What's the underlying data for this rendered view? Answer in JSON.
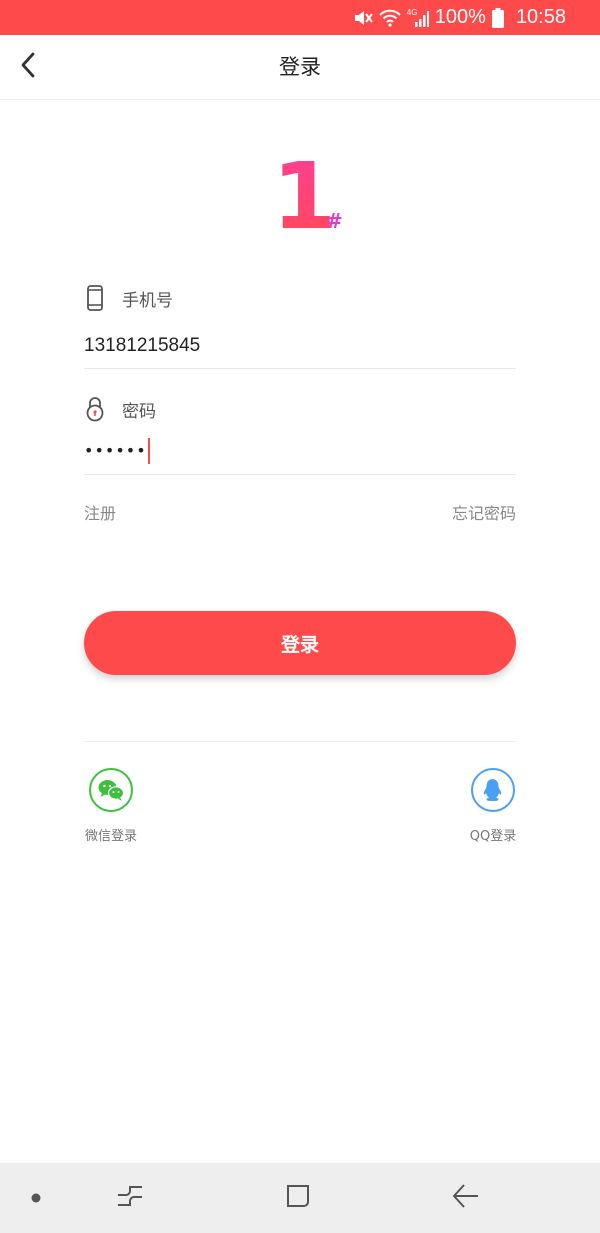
{
  "status_bar": {
    "battery": "100%",
    "clock": "10:58",
    "network": "4G",
    "background": "#ff4a4c"
  },
  "nav": {
    "title": "登录",
    "back_icon": "chevron-left-icon"
  },
  "logo": {
    "number": "1",
    "symbol": "#",
    "gradient": [
      "#ff3d78",
      "#ff6a3d"
    ]
  },
  "form": {
    "phone": {
      "label": "手机号",
      "icon": "phone-icon",
      "value": "13181215845"
    },
    "password": {
      "label": "密码",
      "icon": "lock-icon",
      "masked": "••••••"
    }
  },
  "links": {
    "register": "注册",
    "forgot": "忘记密码"
  },
  "login_button": {
    "label": "登录",
    "color": "#ff4a4c"
  },
  "social": {
    "wechat": {
      "label": "微信登录",
      "icon": "wechat-icon",
      "color": "#3dc13c"
    },
    "qq": {
      "label": "QQ登录",
      "icon": "qq-icon",
      "color": "#4a9ff5"
    }
  },
  "system_nav": {
    "keys": [
      "dot-icon",
      "recents-icon",
      "home-icon",
      "back-arrow-icon"
    ]
  }
}
